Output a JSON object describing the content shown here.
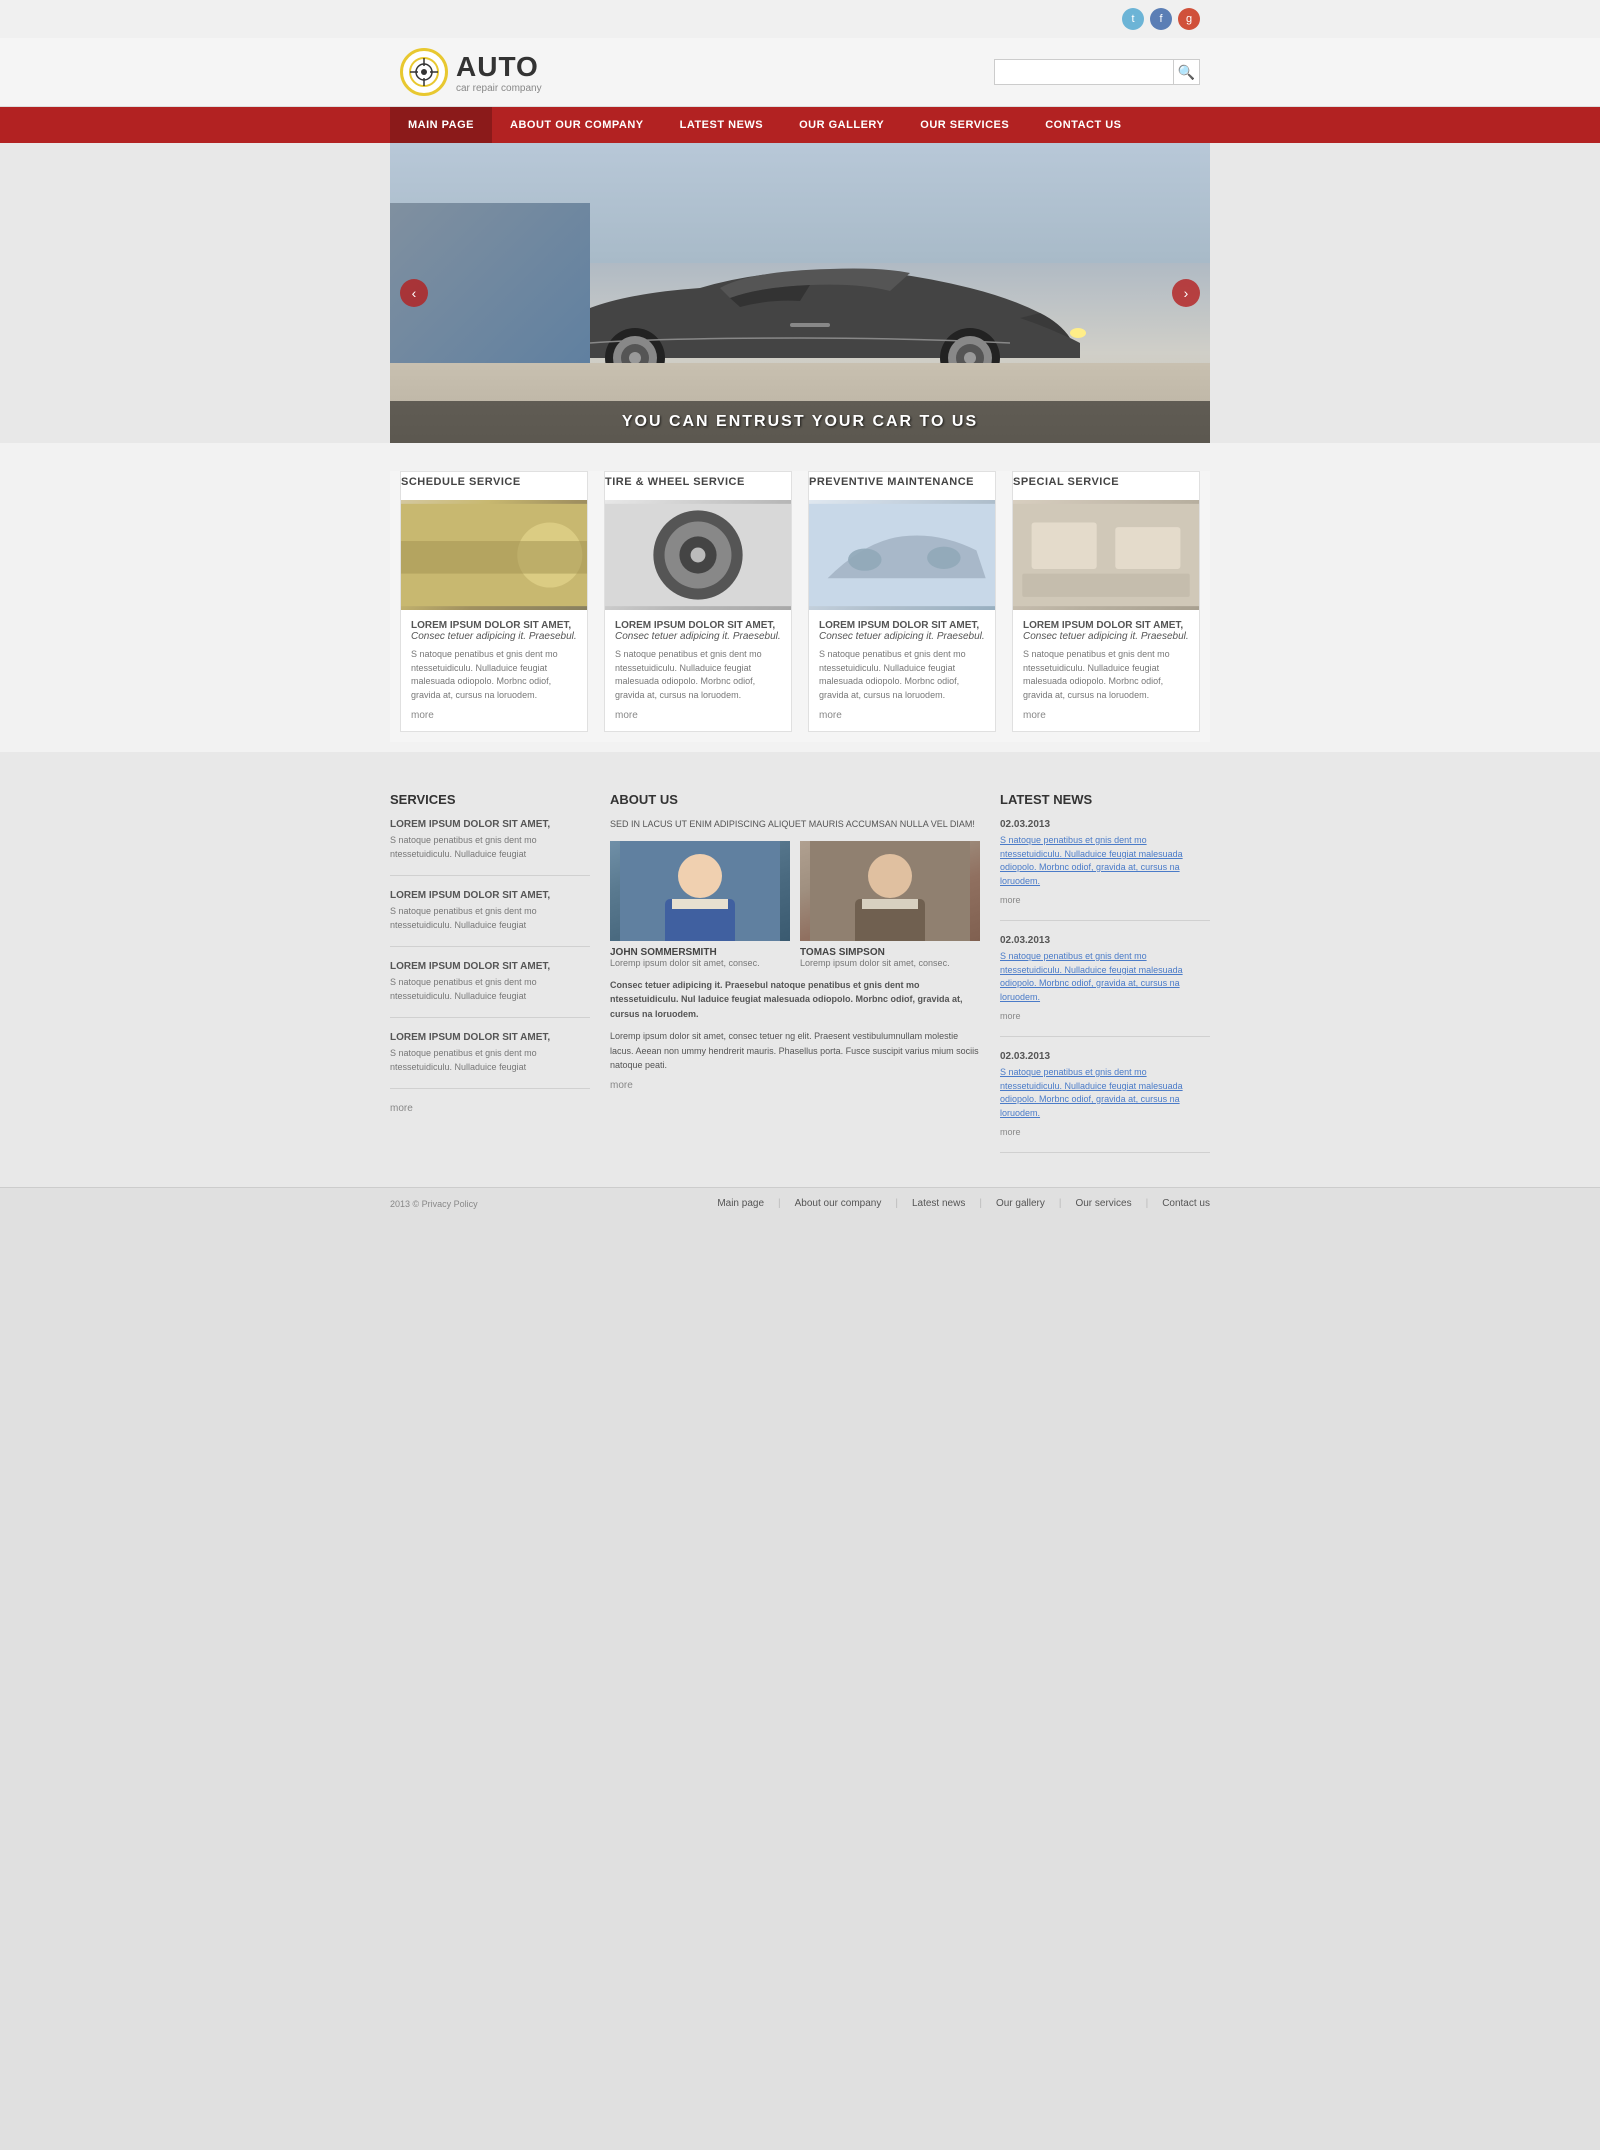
{
  "brand": {
    "logo_icon": "🚗",
    "name": "AUTO",
    "tagline": "car repair company"
  },
  "social": {
    "twitter": "T",
    "facebook": "f",
    "google": "g+"
  },
  "search": {
    "placeholder": ""
  },
  "nav": {
    "items": [
      {
        "label": "MAIN PAGE",
        "active": true
      },
      {
        "label": "ABOUT OUR COMPANY"
      },
      {
        "label": "LATEST NEWS"
      },
      {
        "label": "OUR GALLERY"
      },
      {
        "label": "OUR SERVICES"
      },
      {
        "label": "CONTACT US"
      }
    ]
  },
  "hero": {
    "text": "YOU CAN ENTRUST YOUR CAR TO US"
  },
  "services": [
    {
      "title": "SCHEDULE SERVICE",
      "lorem_header": "LOREM IPSUM DOLOR SIT AMET,",
      "lorem_sub": "Consec tetuer adipicing it. Praesebul.",
      "desc": "S natoque penatibus et gnis dent mo ntessetuidiculu. Nulladuice feugiat malesuada odiopolo. Morbnc odiof, gravida at, cursus na loruodem.",
      "more": "more",
      "img_class": "img-headlight"
    },
    {
      "title": "TIRE & WHEEL SERVICE",
      "lorem_header": "LOREM IPSUM DOLOR SIT AMET,",
      "lorem_sub": "Consec tetuer adipicing it. Praesebul.",
      "desc": "S natoque penatibus et gnis dent mo ntessetuidiculu. Nulladuice feugiat malesuada odiopolo. Morbnc odiof, gravida at, cursus na loruodem.",
      "more": "more",
      "img_class": "img-wheel"
    },
    {
      "title": "PREVENTIVE MAINTENANCE",
      "lorem_header": "LOREM IPSUM DOLOR SIT AMET,",
      "lorem_sub": "Consec tetuer adipicing it. Praesebul.",
      "desc": "S natoque penatibus et gnis dent mo ntessetuidiculu. Nulladuice feugiat malesuada odiopolo. Morbnc odiof, gravida at, cursus na loruodem.",
      "more": "more",
      "img_class": "img-front"
    },
    {
      "title": "SPECIAL SERVICE",
      "lorem_header": "LOREM IPSUM DOLOR SIT AMET,",
      "lorem_sub": "Consec tetuer adipicing it. Praesebul.",
      "desc": "S natoque penatibus et gnis dent mo ntessetuidiculu. Nulladuice feugiat malesuada odiopolo. Morbnc odiof, gravida at, cursus na loruodem.",
      "more": "more",
      "img_class": "img-interior"
    }
  ],
  "bottom": {
    "services_title": "SERVICES",
    "services_items": [
      {
        "title": "LOREM IPSUM DOLOR SIT AMET,",
        "desc": "S natoque penatibus et gnis dent mo ntessetuidiculu. Nulladuice feugiat"
      },
      {
        "title": "LOREM IPSUM DOLOR SIT AMET,",
        "desc": "S natoque penatibus et gnis dent mo ntessetuidiculu. Nulladuice feugiat"
      },
      {
        "title": "LOREM IPSUM DOLOR SIT AMET,",
        "desc": "S natoque penatibus et gnis dent mo ntessetuidiculu. Nulladuice feugiat"
      },
      {
        "title": "LOREM IPSUM DOLOR SIT AMET,",
        "desc": "S natoque penatibus et gnis dent mo ntessetuidiculu. Nulladuice feugiat"
      }
    ],
    "services_more": "more",
    "about_title": "ABOUT US",
    "about_subtitle": "SED IN LACUS UT ENIM ADIPISCING ALIQUET MAURIS ACCUMSAN NULLA VEL DIAM!",
    "team": [
      {
        "name": "JOHN SOMMERSMITH",
        "desc": "Loremp ipsum dolor sit amet, consec.",
        "img_class": "team-mechanic"
      },
      {
        "name": "TOMAS SIMPSON",
        "desc": "Loremp ipsum dolor sit amet, consec.",
        "img_class": "team-senior"
      }
    ],
    "about_body": "Consec tetuer adipicing it. Praesebul natoque penatibus et gnis dent mo ntessetuidiculu. Nul laduice feugiat malesuada odiopolo. Morbnc odiof, gravida at, cursus na loruodem.",
    "about_body2": "Loremp ipsum dolor sit amet, consec tetuer ng elit. Praesent vestibulumnullam molestie lacus. Aeean non ummy hendrerit mauris. Phasellus porta. Fusce suscipit varius mium sociis natoque peati.",
    "about_more": "more",
    "news_title": "LATEST NEWS",
    "news_items": [
      {
        "date": "02.03.2013",
        "text": "S natoque penatibus et gnis dent mo ntessetuidiculu. Nulladuice feugiat malesuada odiopolo. Morbnc odiof, gravida at, cursus na loruodem.",
        "more": "more"
      },
      {
        "date": "02.03.2013",
        "text": "S natoque penatibus et gnis dent mo ntessetuidiculu. Nulladuice feugiat malesuada odiopolo. Morbnc odiof, gravida at, cursus na loruodem.",
        "more": "more"
      },
      {
        "date": "02.03.2013",
        "text": "S natoque penatibus et gnis dent mo ntessetuidiculu. Nulladuice feugiat malesuada odiopolo. Morbnc odiof, gravida at, cursus na loruodem.",
        "more": "more"
      }
    ]
  },
  "footer": {
    "copy": "2013 © Privacy Policy",
    "links": [
      {
        "label": "Main page"
      },
      {
        "label": "About our company"
      },
      {
        "label": "Latest news"
      },
      {
        "label": "Our gallery"
      },
      {
        "label": "Our services"
      },
      {
        "label": "Contact us"
      }
    ]
  },
  "colors": {
    "nav_bg": "#b22222",
    "accent": "#b22222"
  }
}
